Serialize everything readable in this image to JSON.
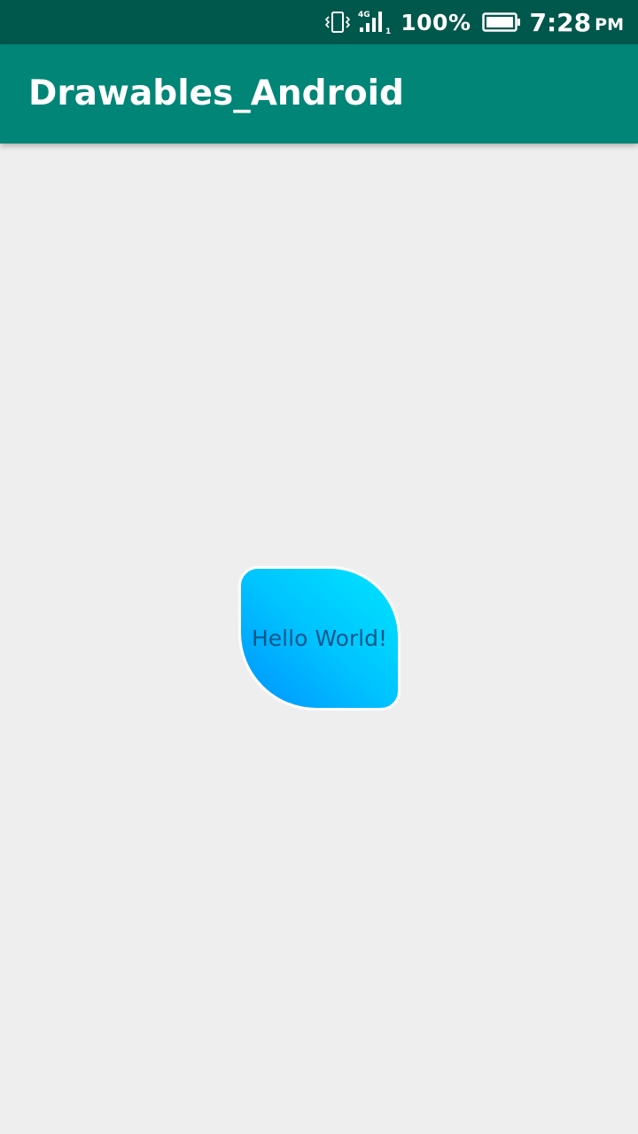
{
  "status_bar": {
    "vibrate_icon": "vibrate-icon",
    "network_type": "4G",
    "sim_slot": "1",
    "battery_percent": "100%",
    "time": "7:28",
    "ampm": "PM",
    "background": "#00574b"
  },
  "app_bar": {
    "title": "Drawables_Android",
    "background": "#008577"
  },
  "main": {
    "hello_text": "Hello World!",
    "gradient_colors": [
      "#0091ff",
      "#00e5ff"
    ],
    "text_color": "#10568c",
    "background": "#eeeeee"
  }
}
